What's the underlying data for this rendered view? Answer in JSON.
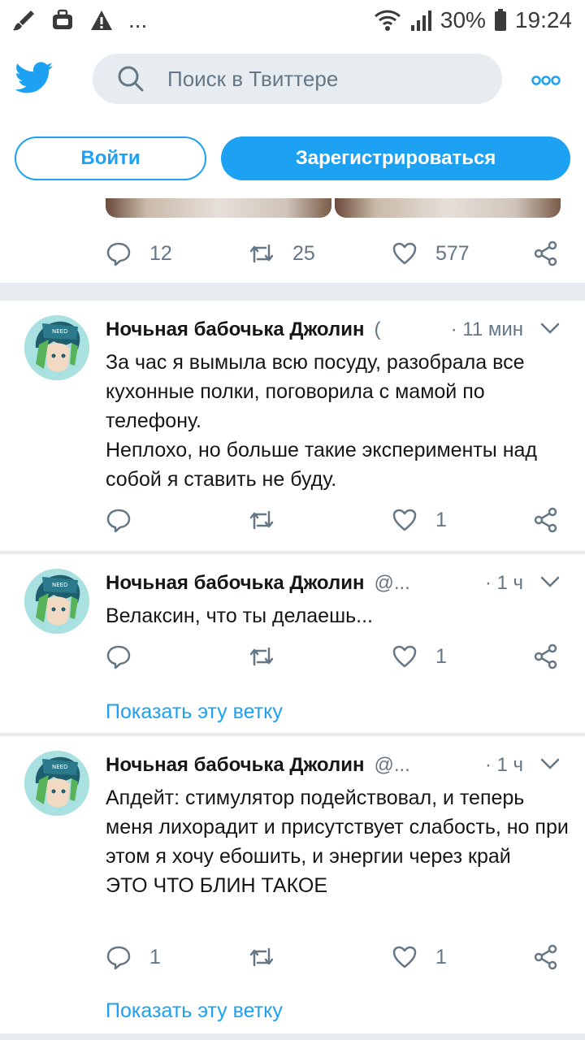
{
  "status_bar": {
    "battery": "30%",
    "time": "19:24",
    "icons": [
      "brush-icon",
      "briefcase-icon",
      "warning-icon",
      "more-notifications-icon",
      "wifi-icon",
      "signal-icon",
      "battery-icon"
    ],
    "dots": "..."
  },
  "header": {
    "search_placeholder": "Поиск в Твиттере",
    "login_label": "Войти",
    "signup_label": "Зарегистрироваться",
    "accent_color": "#1da1f2"
  },
  "tweets": [
    {
      "replies": "12",
      "retweets": "25",
      "likes": "577"
    },
    {
      "author": "Ночьная бабочька Джолин",
      "handle": "(",
      "time": "· 11 мин",
      "lines": [
        "За час я вымыла всю посуду, разобрала все кухонные полки, поговорила с мамой по телефону.",
        "Неплохо, но больше такие эксперименты над собой я ставить не буду."
      ],
      "replies": "",
      "retweets": "",
      "likes": "1"
    },
    {
      "author": "Ночьная бабочька Джолин",
      "handle": "@...",
      "time": "· 1 ч",
      "lines": [
        "Велаксин, что ты делаешь..."
      ],
      "replies": "",
      "retweets": "",
      "likes": "1",
      "thread_link": "Показать эту ветку"
    },
    {
      "author": "Ночьная бабочька Джолин",
      "handle": "@...",
      "time": "· 1 ч",
      "lines": [
        "Апдейт: стимулятор подействовал, и теперь меня лихорадит и присутствует слабость, но при этом я хочу ебошить, и энергии через край",
        "ЭТО ЧТО БЛИН ТАКОЕ"
      ],
      "replies": "1",
      "retweets": "",
      "likes": "1",
      "thread_link": "Показать эту ветку"
    }
  ]
}
